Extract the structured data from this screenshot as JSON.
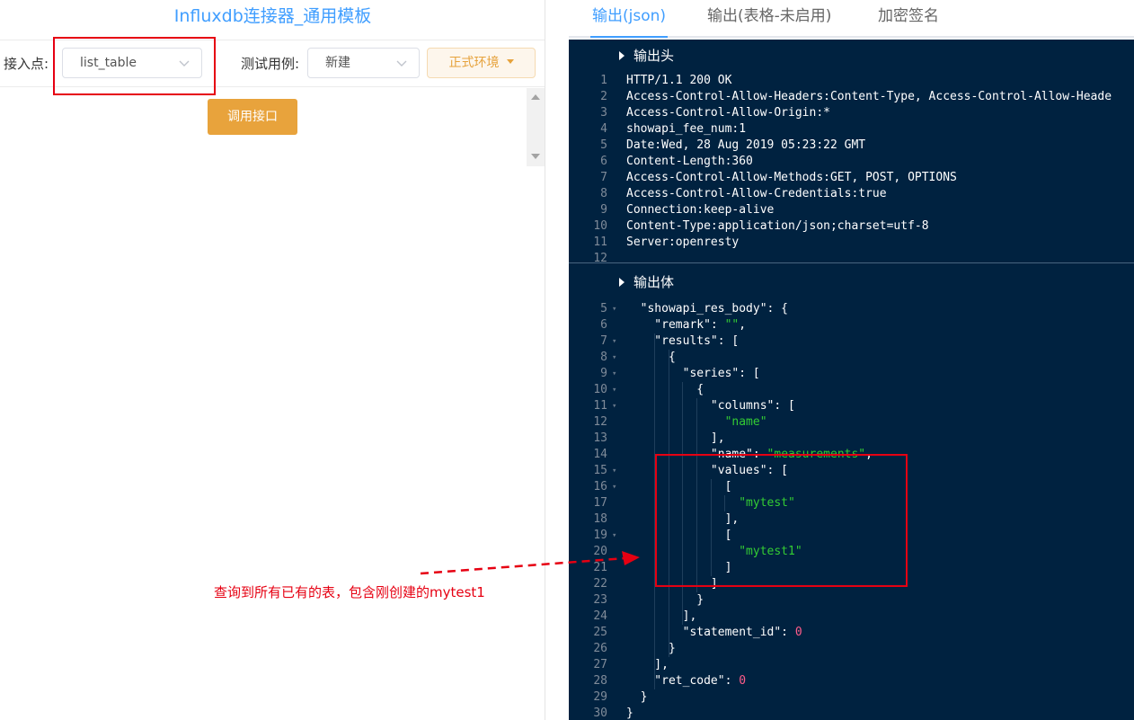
{
  "left": {
    "title": "Influxdb连接器_通用模板",
    "entry_label": "接入点:",
    "entry_value": "list_table",
    "testcase_label": "测试用例:",
    "testcase_value": "新建",
    "env_button": "正式环境",
    "call_button": "调用接口"
  },
  "annotation": {
    "text": "查询到所有已有的表，包含刚创建的mytest1",
    "color": "#e60012"
  },
  "right": {
    "tabs": [
      {
        "label": "输出(json)"
      },
      {
        "label": "输出(表格-未启用)"
      },
      {
        "label": "加密签名"
      }
    ],
    "header_section": {
      "title": "输出头",
      "lines": [
        {
          "n": "1",
          "t": "HTTP/1.1 200 OK"
        },
        {
          "n": "2",
          "t": "Access-Control-Allow-Headers:Content-Type, Access-Control-Allow-Heade"
        },
        {
          "n": "3",
          "t": "Access-Control-Allow-Origin:*"
        },
        {
          "n": "4",
          "t": "showapi_fee_num:1"
        },
        {
          "n": "5",
          "t": "Date:Wed, 28 Aug 2019 05:23:22 GMT"
        },
        {
          "n": "6",
          "t": "Content-Length:360"
        },
        {
          "n": "7",
          "t": "Access-Control-Allow-Methods:GET, POST, OPTIONS"
        },
        {
          "n": "8",
          "t": "Access-Control-Allow-Credentials:true"
        },
        {
          "n": "9",
          "t": "Connection:keep-alive"
        },
        {
          "n": "10",
          "t": "Content-Type:application/json;charset=utf-8"
        },
        {
          "n": "11",
          "t": "Server:openresty"
        },
        {
          "n": "12",
          "t": ""
        }
      ]
    },
    "body_section": {
      "title": "输出体",
      "lines": [
        {
          "n": "5",
          "fold": true,
          "parts": [
            [
              "k",
              "  \"showapi_res_body\": {"
            ]
          ]
        },
        {
          "n": "6",
          "fold": false,
          "parts": [
            [
              "k",
              "    \"remark\": "
            ],
            [
              "s",
              "\"\""
            ],
            [
              "k",
              ","
            ]
          ]
        },
        {
          "n": "7",
          "fold": true,
          "parts": [
            [
              "k",
              "    \"results\": ["
            ]
          ]
        },
        {
          "n": "8",
          "fold": true,
          "parts": [
            [
              "k",
              "      {"
            ]
          ]
        },
        {
          "n": "9",
          "fold": true,
          "parts": [
            [
              "k",
              "        \"series\": ["
            ]
          ]
        },
        {
          "n": "10",
          "fold": true,
          "parts": [
            [
              "k",
              "          {"
            ]
          ]
        },
        {
          "n": "11",
          "fold": true,
          "parts": [
            [
              "k",
              "            \"columns\": ["
            ]
          ]
        },
        {
          "n": "12",
          "fold": false,
          "parts": [
            [
              "s",
              "              \"name\""
            ]
          ]
        },
        {
          "n": "13",
          "fold": false,
          "parts": [
            [
              "k",
              "            ],"
            ]
          ]
        },
        {
          "n": "14",
          "fold": false,
          "parts": [
            [
              "k",
              "            \"name\": "
            ],
            [
              "s",
              "\"measurements\""
            ],
            [
              "k",
              ","
            ]
          ]
        },
        {
          "n": "15",
          "fold": true,
          "parts": [
            [
              "k",
              "            \"values\": ["
            ]
          ]
        },
        {
          "n": "16",
          "fold": true,
          "parts": [
            [
              "k",
              "              ["
            ]
          ]
        },
        {
          "n": "17",
          "fold": false,
          "parts": [
            [
              "s",
              "                \"mytest\""
            ]
          ]
        },
        {
          "n": "18",
          "fold": false,
          "parts": [
            [
              "k",
              "              ],"
            ]
          ]
        },
        {
          "n": "19",
          "fold": true,
          "parts": [
            [
              "k",
              "              ["
            ]
          ]
        },
        {
          "n": "20",
          "fold": false,
          "parts": [
            [
              "s",
              "                \"mytest1\""
            ]
          ]
        },
        {
          "n": "21",
          "fold": false,
          "parts": [
            [
              "k",
              "              ]"
            ]
          ]
        },
        {
          "n": "22",
          "fold": false,
          "parts": [
            [
              "k",
              "            ]"
            ]
          ]
        },
        {
          "n": "23",
          "fold": false,
          "parts": [
            [
              "k",
              "          }"
            ]
          ]
        },
        {
          "n": "24",
          "fold": false,
          "parts": [
            [
              "k",
              "        ],"
            ]
          ]
        },
        {
          "n": "25",
          "fold": false,
          "parts": [
            [
              "k",
              "        \"statement_id\": "
            ],
            [
              "n",
              "0"
            ]
          ]
        },
        {
          "n": "26",
          "fold": false,
          "parts": [
            [
              "k",
              "      }"
            ]
          ]
        },
        {
          "n": "27",
          "fold": false,
          "parts": [
            [
              "k",
              "    ],"
            ]
          ]
        },
        {
          "n": "28",
          "fold": false,
          "parts": [
            [
              "k",
              "    \"ret_code\": "
            ],
            [
              "n",
              "0"
            ]
          ]
        },
        {
          "n": "29",
          "fold": false,
          "parts": [
            [
              "k",
              "  }"
            ]
          ]
        },
        {
          "n": "30",
          "fold": false,
          "parts": [
            [
              "k",
              "}"
            ]
          ]
        }
      ]
    }
  }
}
